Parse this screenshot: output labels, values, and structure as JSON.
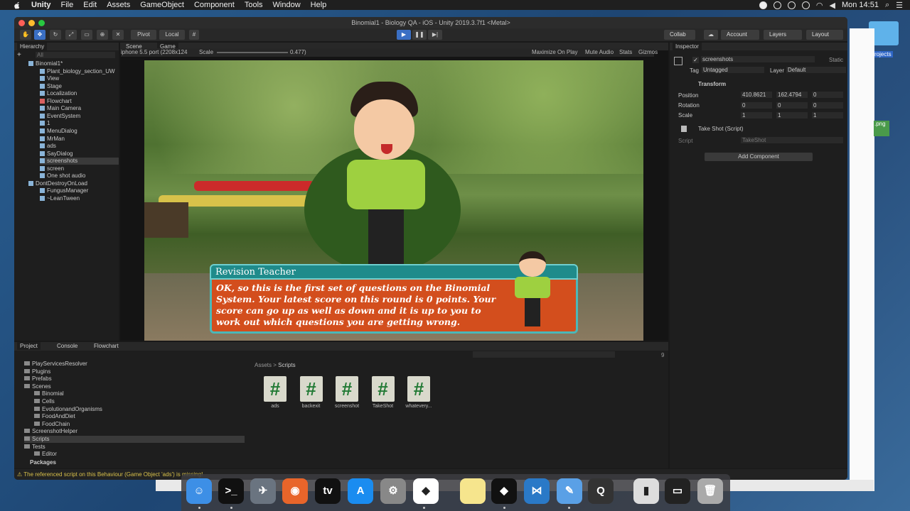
{
  "menubar": {
    "app_name": "Unity",
    "items": [
      "File",
      "Edit",
      "Assets",
      "GameObject",
      "Component",
      "Tools",
      "Window",
      "Help"
    ],
    "clock": "Mon 14:51"
  },
  "window": {
    "title": "Binomial1 - Biology QA - iOS - Unity 2019.3.7f1 <Metal>"
  },
  "toolbar": {
    "pivot": "Pivot",
    "local": "Local",
    "collab": "Collab",
    "account": "Account",
    "layers": "Layers",
    "layout": "Layout"
  },
  "hierarchy": {
    "tab": "Hierarchy",
    "search_placeholder": "All",
    "items": [
      {
        "label": "Binomial1*",
        "depth": 0,
        "icon": "scene"
      },
      {
        "label": "Plant_biology_section_UW",
        "depth": 1,
        "icon": "cube"
      },
      {
        "label": "View",
        "depth": 1,
        "icon": "cube"
      },
      {
        "label": "Stage",
        "depth": 1,
        "icon": "cube"
      },
      {
        "label": "Localization",
        "depth": 1,
        "icon": "cube"
      },
      {
        "label": "Flowchart",
        "depth": 1,
        "icon": "red"
      },
      {
        "label": "Main Camera",
        "depth": 1,
        "icon": "cube"
      },
      {
        "label": "EventSystem",
        "depth": 1,
        "icon": "cube"
      },
      {
        "label": "1",
        "depth": 1,
        "icon": "cube"
      },
      {
        "label": "MenuDialog",
        "depth": 1,
        "icon": "cube"
      },
      {
        "label": "MrMan",
        "depth": 1,
        "icon": "cube"
      },
      {
        "label": "ads",
        "depth": 1,
        "icon": "cube"
      },
      {
        "label": "SayDialog",
        "depth": 1,
        "icon": "cube"
      },
      {
        "label": "screenshots",
        "depth": 1,
        "icon": "cube"
      },
      {
        "label": "screen",
        "depth": 1,
        "icon": "cube"
      },
      {
        "label": "One shot audio",
        "depth": 1,
        "icon": "cube"
      },
      {
        "label": "DontDestroyOnLoad",
        "depth": 0,
        "icon": "scene"
      },
      {
        "label": "FungusManager",
        "depth": 1,
        "icon": "cube"
      },
      {
        "label": "~LeanTween",
        "depth": 1,
        "icon": "cube"
      }
    ]
  },
  "scene_tabs": {
    "scene": "Scene",
    "game": "Game"
  },
  "game_bar": {
    "resolution": "iphone 5.5 port (2208x124",
    "scale_label": "Scale",
    "scale_value": "0.477)",
    "maximize": "Maximize On Play",
    "mute": "Mute Audio",
    "stats": "Stats",
    "gizmos": "Gizmos"
  },
  "dialog": {
    "name": "Revision Teacher",
    "text": "OK, so this is the first set of questions on the Binomial System. Your latest score on this round is 0 points. Your score can go up as well as down and it is up to you to work out which questions you are getting wrong."
  },
  "inspector": {
    "tab": "Inspector",
    "object_name": "screenshots",
    "static_label": "Static",
    "tag_label": "Tag",
    "tag_value": "Untagged",
    "layer_label": "Layer",
    "layer_value": "Default",
    "transform": "Transform",
    "position_label": "Position",
    "pos_x": "410.8621",
    "pos_y": "162.4794",
    "pos_z": "0",
    "rotation_label": "Rotation",
    "rot_x": "0",
    "rot_y": "0",
    "rot_z": "0",
    "scale_label": "Scale",
    "scale_x": "1",
    "scale_y": "1",
    "scale_z": "1",
    "component": "Take Shot (Script)",
    "script_label": "Script",
    "script_value": "TakeShot",
    "add_component": "Add Component"
  },
  "project": {
    "tabs": [
      "Project",
      "Console",
      "Flowchart"
    ],
    "tree": [
      {
        "label": "PlayServicesResolver",
        "depth": 0
      },
      {
        "label": "Plugins",
        "depth": 0
      },
      {
        "label": "Prefabs",
        "depth": 0
      },
      {
        "label": "Scenes",
        "depth": 0
      },
      {
        "label": "Binomial",
        "depth": 1
      },
      {
        "label": "Cells",
        "depth": 1
      },
      {
        "label": "EvolutionandOrganisms",
        "depth": 1
      },
      {
        "label": "FoodAndDiet",
        "depth": 1
      },
      {
        "label": "FoodChain",
        "depth": 1
      },
      {
        "label": "ScreenshotHelper",
        "depth": 0
      },
      {
        "label": "Scripts",
        "depth": 0
      },
      {
        "label": "Tests",
        "depth": 0
      },
      {
        "label": "Editor",
        "depth": 1
      }
    ],
    "packages": "Packages",
    "breadcrumb_root": "Assets",
    "breadcrumb_leaf": "Scripts",
    "assets": [
      "ads",
      "backexit",
      "screenshot",
      "TakeShot",
      "whatevery..."
    ],
    "count": "9"
  },
  "status": {
    "warning": "The referenced script on this Behaviour (Game Object 'ads') is missing!"
  },
  "desktop": {
    "projects_label": "rojects",
    "png_label": ".png"
  },
  "dock": [
    "finder",
    "terminal",
    "rocket",
    "firefox",
    "tv",
    "appstore",
    "settings",
    "unity-hub",
    "notes",
    "unity",
    "vscode",
    "xcode",
    "quicktime",
    "archive",
    "screen",
    "trash"
  ]
}
